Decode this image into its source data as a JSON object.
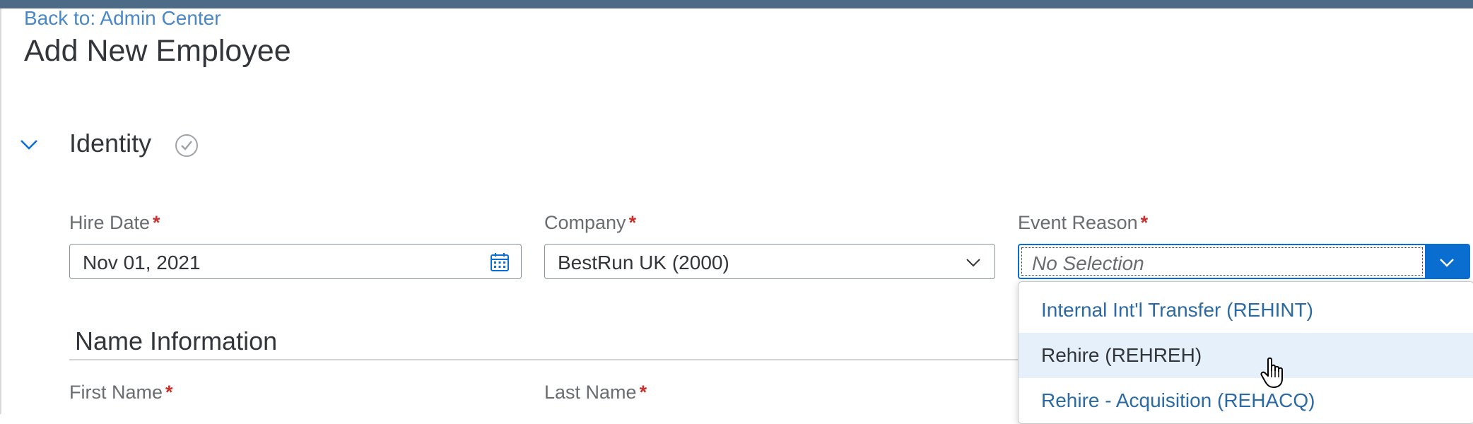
{
  "header": {
    "back_link": "Back to: Admin Center",
    "page_title": "Add New Employee"
  },
  "identity_section": {
    "title": "Identity",
    "status_icon": "check-circle-icon",
    "expand_icon": "chevron-down-icon",
    "fields": {
      "hire_date": {
        "label": "Hire Date",
        "required": "*",
        "value": "Nov 01, 2021",
        "icon": "calendar-icon"
      },
      "company": {
        "label": "Company",
        "required": "*",
        "value": "BestRun UK (2000)",
        "icon": "chevron-down-icon"
      },
      "event_reason": {
        "label": "Event Reason",
        "required": "*",
        "placeholder": "No Selection",
        "icon": "chevron-down-icon"
      }
    }
  },
  "event_reason_dropdown": {
    "options": [
      {
        "label": "Internal Int'l Transfer (REHINT)"
      },
      {
        "label": "Rehire (REHREH)",
        "hovered": true
      },
      {
        "label": "Rehire - Acquisition (REHACQ)"
      }
    ]
  },
  "name_section": {
    "title": "Name Information",
    "first_name_label": "First Name",
    "last_name_label": "Last Name",
    "required": "*"
  },
  "colors": {
    "top_bar": "#4d6b87",
    "link": "#4a88c5",
    "accent": "#0a6ed1",
    "required": "#c9302c",
    "hover_row": "#e5f0fa"
  }
}
